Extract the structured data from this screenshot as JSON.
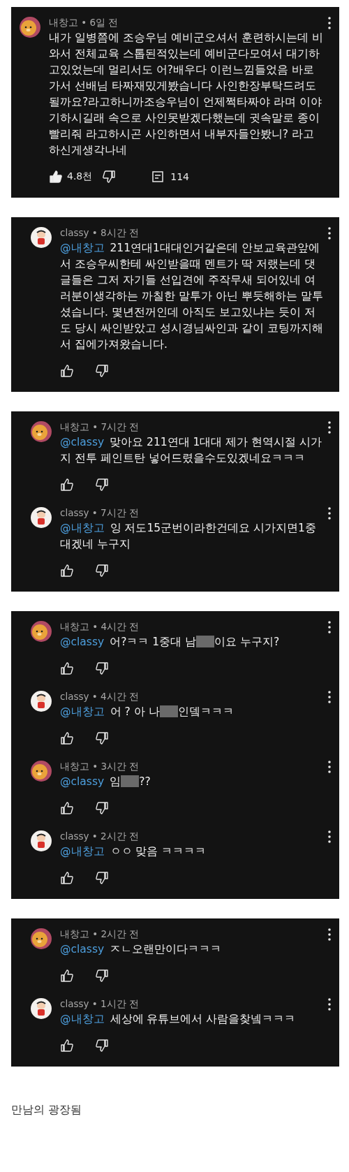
{
  "panels": [
    {
      "comments": [
        {
          "kind": "lion",
          "byline": "내창고 • 6일 전",
          "segments": [
            {
              "kind": "text",
              "text": "내가 일병쯤에 조승우님 예비군오셔서 훈련하시는데 비와서 전체교육 스톱된적있는데 예비군다모여서 대기하고있었는데 멀리서도 어?배우다 이런느낌들었음 바로가서 선배님 타짜재밌게봤습니다 사인한장부탁드려도될까요?라고하니까조승우님이 언제쩍타짜야 라며 이야기하시길래 속으로 사인못받겠다했는데 귓속말로 종이빨리줘 라고하시곤 사인하면서 내부자들안봤니? 라고하신게생각나네"
            }
          ],
          "liked": true,
          "likes": "4.8천",
          "replies": "114"
        }
      ]
    },
    {
      "comments": [
        {
          "kind": "child",
          "byline": "classy • 8시간 전",
          "mention": "@내창고",
          "segments": [
            {
              "kind": "text",
              "text": "211연대1대대인거같은데 안보교육관앞에서 조승우씨한테 싸인받을때 멘트가 딱 저랬는데  댓글들은 그저 자기들 선입견에 주작무새 되어있네 여러분이생각하는 까칠한 말투가 아닌 뿌듯해하는 말투셨습니다. 몇년전꺼인데 아직도 보고있냐는 듯이 저도 당시 싸인받았고 성시경님싸인과 같이 코팅까지해서 집에가져왔습니다."
            }
          ],
          "liked": false
        }
      ]
    },
    {
      "comments": [
        {
          "kind": "lion",
          "byline": "내창고 • 7시간 전",
          "mention": "@classy",
          "segments": [
            {
              "kind": "text",
              "text": "맞아요 211연대 1대대 제가 현역시절 시가지 전투 페인트탄 넣어드렸을수도있겠네요ㅋㅋㅋ"
            }
          ],
          "liked": false
        },
        {
          "kind": "child",
          "byline": "classy • 7시간 전",
          "mention": "@내창고",
          "segments": [
            {
              "kind": "text",
              "text": "잉 저도15군번이라한건데요 시가지면1중대겠네 누구지"
            }
          ],
          "liked": false
        }
      ]
    },
    {
      "comments": [
        {
          "kind": "lion",
          "byline": "내창고 • 4시간 전",
          "mention": "@classy",
          "segments": [
            {
              "kind": "text",
              "text": "어?ㅋㅋ 1중대 남"
            },
            {
              "kind": "redacted"
            },
            {
              "kind": "text",
              "text": "이요 누구지?"
            }
          ],
          "liked": false
        },
        {
          "kind": "child",
          "byline": "classy • 4시간 전",
          "mention": "@내창고",
          "segments": [
            {
              "kind": "text",
              "text": "어 ? 아 나"
            },
            {
              "kind": "redacted"
            },
            {
              "kind": "text",
              "text": "인뎈ㅋㅋㅋ"
            }
          ],
          "liked": false
        },
        {
          "kind": "lion",
          "byline": "내창고 • 3시간 전",
          "mention": "@classy",
          "segments": [
            {
              "kind": "text",
              "text": "임"
            },
            {
              "kind": "redacted"
            },
            {
              "kind": "text",
              "text": "??"
            }
          ],
          "liked": false
        },
        {
          "kind": "child",
          "byline": "classy • 2시간 전",
          "mention": "@내창고",
          "segments": [
            {
              "kind": "text",
              "text": "ㅇㅇ 맞음 ㅋㅋㅋㅋ"
            }
          ],
          "liked": false
        }
      ]
    },
    {
      "comments": [
        {
          "kind": "lion",
          "byline": "내창고 • 2시간 전",
          "mention": "@classy",
          "segments": [
            {
              "kind": "text",
              "text": "ㅈㄴ오랜만이다ㅋㅋㅋ"
            }
          ],
          "liked": false
        },
        {
          "kind": "child",
          "byline": "classy • 1시간 전",
          "mention": "@내창고",
          "segments": [
            {
              "kind": "text",
              "text": "세상에 유튜브에서 사람을찾넼ㅋㅋㅋ"
            }
          ],
          "liked": false
        }
      ]
    }
  ],
  "caption": "만남의 광장됨"
}
